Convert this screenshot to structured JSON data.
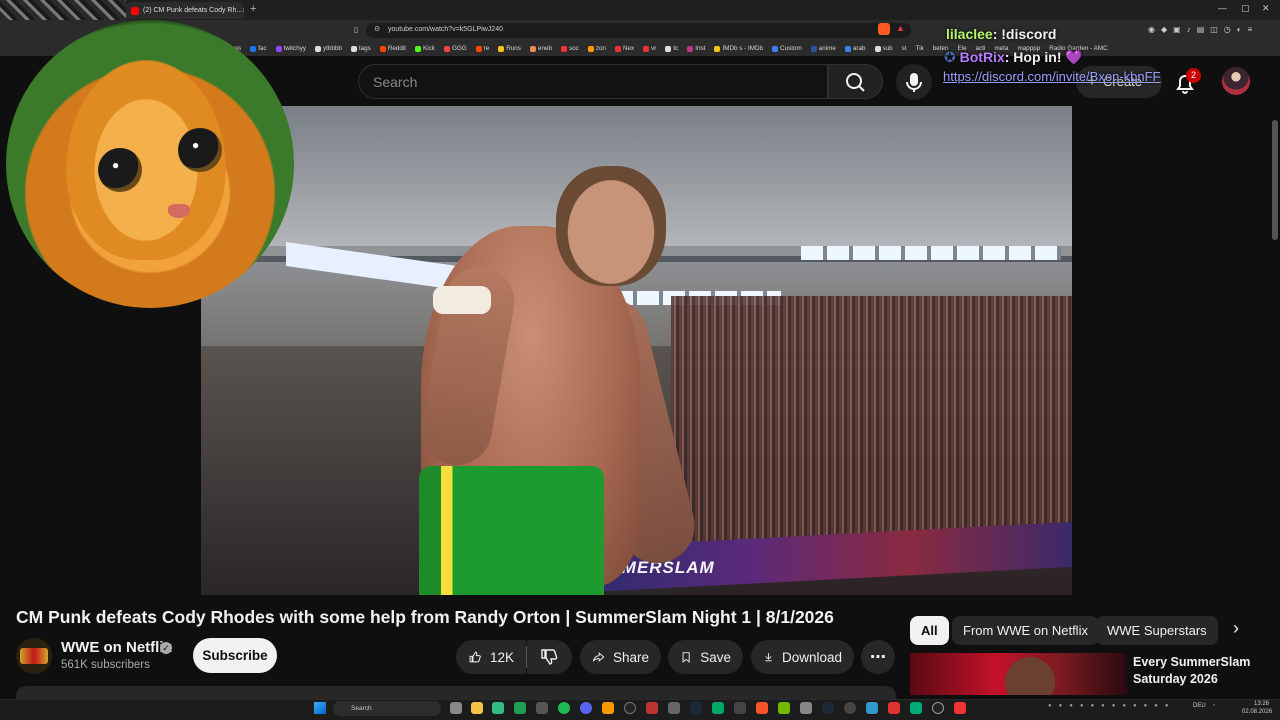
{
  "browser": {
    "tab_title": "(2) CM Punk defeats Cody Rh...",
    "tab_close": "×",
    "new_tab": "+",
    "url": "youtube.com/watch?v=k5GLPiwJ240",
    "bookmarks": [
      "was",
      "fac",
      "twitchyy",
      "ytbbbb",
      "tags",
      "Reddit",
      "Kick",
      "GGG",
      "re",
      "Runs",
      "eneb",
      "soc",
      "zon",
      "Nex",
      "vr",
      "tc",
      "Inst",
      "IMDb s - IMDb",
      "Custom",
      "anime",
      "arab",
      "sub",
      "st",
      "Tik",
      "beten",
      "Ele",
      "acti",
      "meta",
      "mapppp",
      "Radio Garden - AMC"
    ]
  },
  "youtube": {
    "search_placeholder": "Search",
    "create_label": "Create",
    "notification_count": "2",
    "video_title": "CM Punk defeats Cody Rhodes with some help from Randy Orton | SummerSlam Night 1 | 8/1/2026",
    "channel_name": "WWE on Netflix",
    "subscriber_count": "561K subscribers",
    "subscribe_label": "Subscribe",
    "like_count": "12K",
    "share_label": "Share",
    "save_label": "Save",
    "download_label": "Download",
    "more_label": "⋯",
    "chips": [
      "All",
      "From WWE on Netflix",
      "WWE Superstars"
    ],
    "chip_next": "›",
    "recommended_title": "Every SummerSlam Saturday 2026",
    "video_banner_text": "SUMMERSLAM"
  },
  "chat_overlay": {
    "line1_name": "lilaclee",
    "line1_text": ": !discord",
    "line2_name": "BotRix",
    "line2_text": ": Hop in! 💜",
    "line3_link": "https://discord.com/invite/Bxen-kbnFF"
  },
  "taskbar": {
    "search_label": "Search",
    "lang": "DEU",
    "time": "13:26",
    "date": "02.08.2026"
  },
  "colors": {
    "background": "#0f0f0f",
    "youtube_red": "#ff0000",
    "chat_green": "#b6f56b",
    "chat_purple": "#b57cff"
  }
}
